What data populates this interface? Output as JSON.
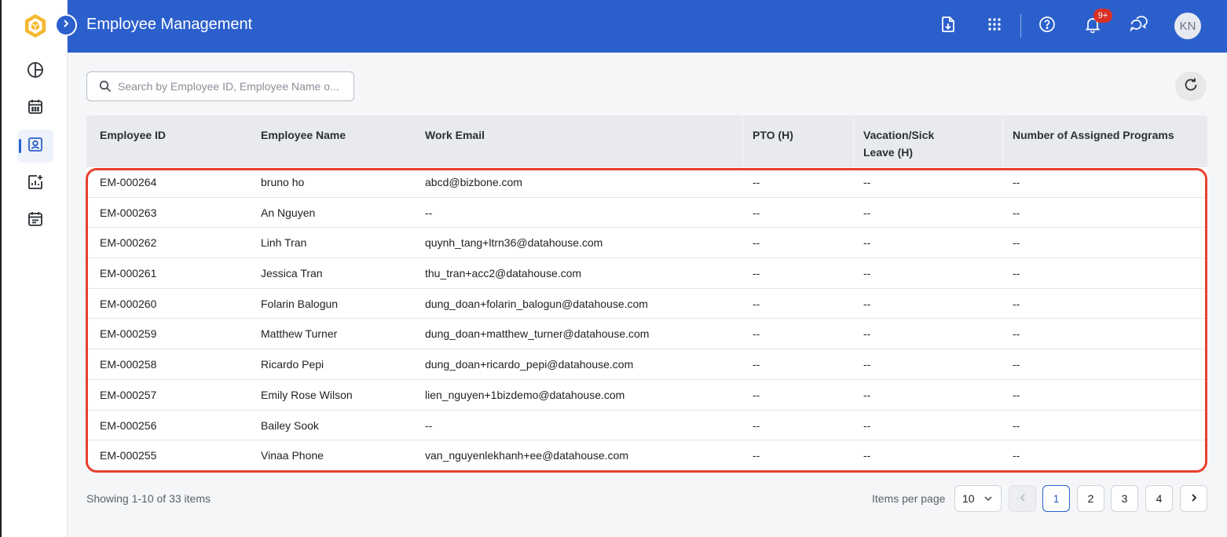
{
  "header": {
    "title": "Employee Management",
    "notification_badge": "9+",
    "avatar_initials": "KN"
  },
  "sidebar": {
    "items": [
      {
        "icon": "pie-chart-icon"
      },
      {
        "icon": "calendar-icon"
      },
      {
        "icon": "employee-badge-icon",
        "active": true
      },
      {
        "icon": "add-report-icon"
      },
      {
        "icon": "schedule-icon"
      }
    ]
  },
  "search": {
    "placeholder": "Search by Employee ID, Employee Name o..."
  },
  "table": {
    "columns": [
      "Employee ID",
      "Employee Name",
      "Work Email",
      "PTO (H)",
      "Vacation/Sick\nLeave (H)",
      "Number of Assigned Programs"
    ],
    "rows": [
      [
        "EM-000264",
        "bruno ho",
        "abcd@bizbone.com",
        "--",
        "--",
        "--"
      ],
      [
        "EM-000263",
        "An Nguyen",
        "--",
        "--",
        "--",
        "--"
      ],
      [
        "EM-000262",
        "Linh Tran",
        "quynh_tang+ltrn36@datahouse.com",
        "--",
        "--",
        "--"
      ],
      [
        "EM-000261",
        "Jessica Tran",
        "thu_tran+acc2@datahouse.com",
        "--",
        "--",
        "--"
      ],
      [
        "EM-000260",
        "Folarin Balogun",
        "dung_doan+folarin_balogun@datahouse.com",
        "--",
        "--",
        "--"
      ],
      [
        "EM-000259",
        "Matthew Turner",
        "dung_doan+matthew_turner@datahouse.com",
        "--",
        "--",
        "--"
      ],
      [
        "EM-000258",
        "Ricardo Pepi",
        "dung_doan+ricardo_pepi@datahouse.com",
        "--",
        "--",
        "--"
      ],
      [
        "EM-000257",
        "Emily Rose Wilson",
        "lien_nguyen+1bizdemo@datahouse.com",
        "--",
        "--",
        "--"
      ],
      [
        "EM-000256",
        "Bailey Sook",
        "--",
        "--",
        "--",
        "--"
      ],
      [
        "EM-000255",
        "Vinaa Phone",
        "van_nguyenlekhanh+ee@datahouse.com",
        "--",
        "--",
        "--"
      ]
    ]
  },
  "footer": {
    "showing": "Showing 1-10 of 33 items",
    "items_per_page_label": "Items per page",
    "items_per_page_value": "10",
    "pages": [
      "1",
      "2",
      "3",
      "4"
    ],
    "current_page": "1"
  },
  "colors": {
    "header_bg": "#2b5fcc",
    "highlight_border": "#e8412c",
    "badge": "#d93025"
  }
}
